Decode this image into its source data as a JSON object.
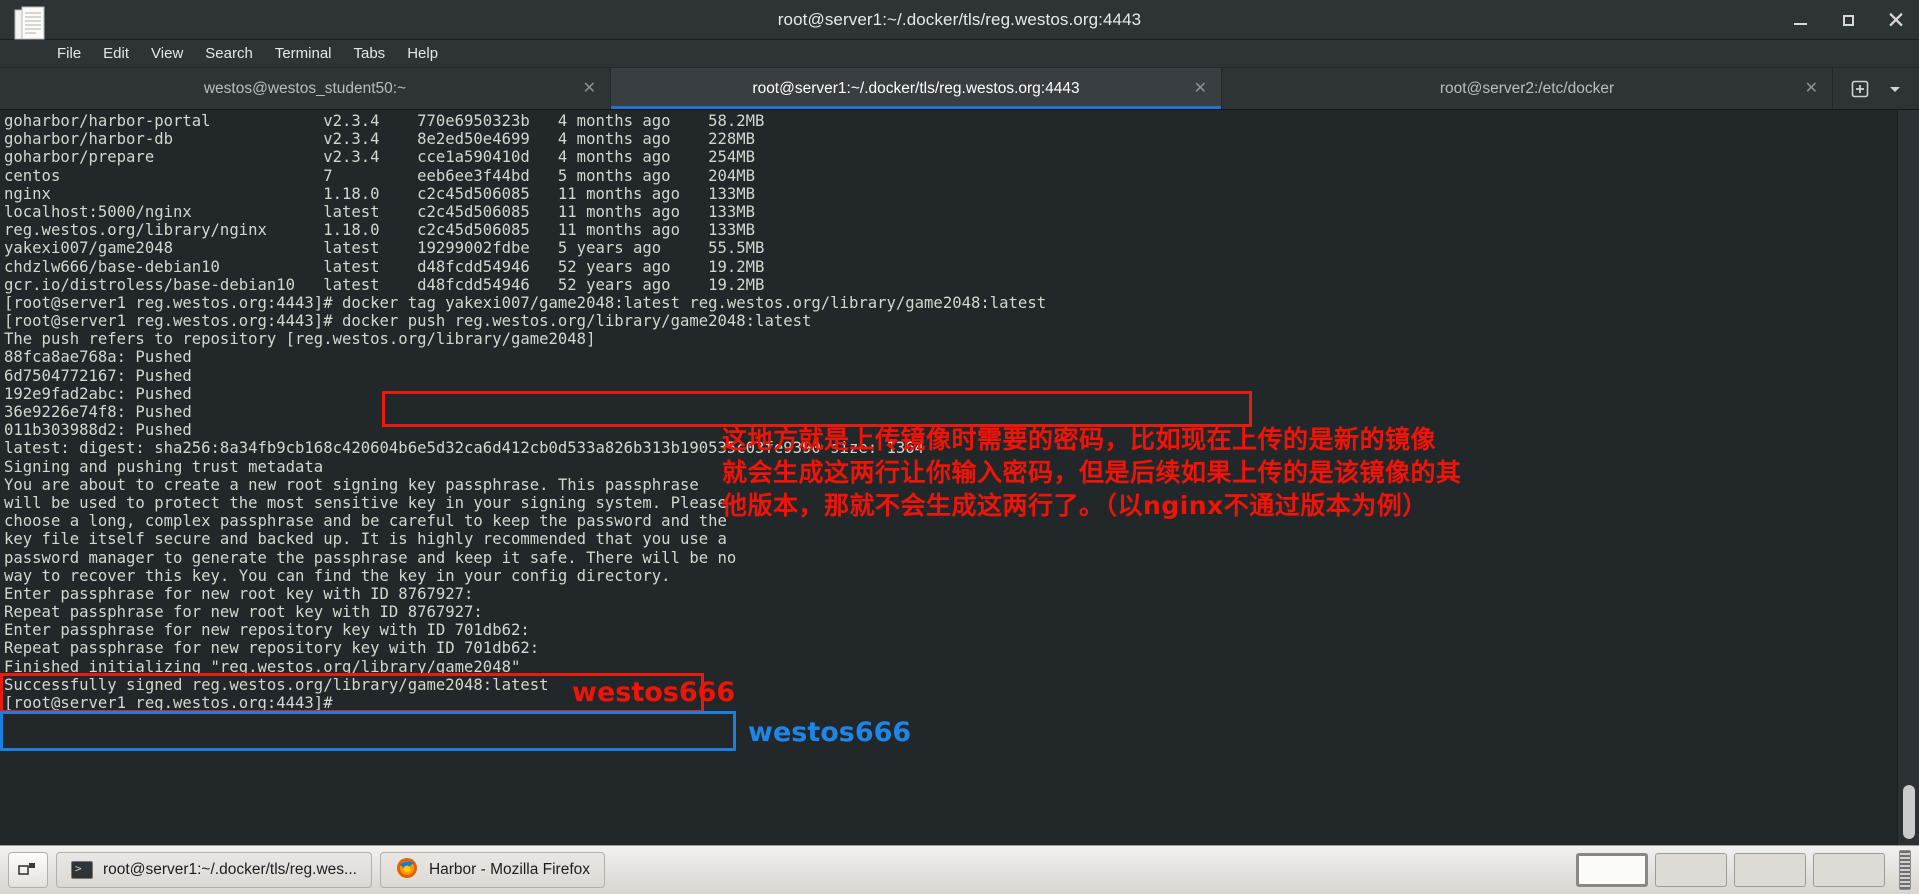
{
  "window": {
    "title": "root@server1:~/.docker/tls/reg.westos.org:4443",
    "minimize_label": "–",
    "maximize_label": "□",
    "close_label": "✕",
    "app_icon": "document-icon"
  },
  "menubar": {
    "items": [
      {
        "label": "File"
      },
      {
        "label": "Edit"
      },
      {
        "label": "View"
      },
      {
        "label": "Search"
      },
      {
        "label": "Terminal"
      },
      {
        "label": "Tabs"
      },
      {
        "label": "Help"
      }
    ]
  },
  "tabs": {
    "items": [
      {
        "label": "westos@westos_student50:~",
        "active": false,
        "close": "✕"
      },
      {
        "label": "root@server1:~/.docker/tls/reg.westos.org:4443",
        "active": true,
        "close": "✕"
      },
      {
        "label": "root@server2:/etc/docker",
        "active": false,
        "close": "✕"
      }
    ],
    "new_tab_icon": "new-tab-icon",
    "menu_icon": "chevron-down-icon"
  },
  "terminal": {
    "lines": [
      "goharbor/harbor-portal            v2.3.4    770e6950323b   4 months ago    58.2MB",
      "goharbor/harbor-db                v2.3.4    8e2ed50e4699   4 months ago    228MB",
      "goharbor/prepare                  v2.3.4    cce1a590410d   4 months ago    254MB",
      "centos                            7         eeb6ee3f44bd   5 months ago    204MB",
      "nginx                             1.18.0    c2c45d506085   11 months ago   133MB",
      "localhost:5000/nginx              latest    c2c45d506085   11 months ago   133MB",
      "reg.westos.org/library/nginx      1.18.0    c2c45d506085   11 months ago   133MB",
      "yakexi007/game2048                latest    19299002fdbe   5 years ago     55.5MB",
      "chdzlw666/base-debian10           latest    d48fcdd54946   52 years ago    19.2MB",
      "gcr.io/distroless/base-debian10   latest    d48fcdd54946   52 years ago    19.2MB",
      "[root@server1 reg.westos.org:4443]# docker tag yakexi007/game2048:latest reg.westos.org/library/game2048:latest",
      "[root@server1 reg.westos.org:4443]# docker push reg.westos.org/library/game2048:latest",
      "The push refers to repository [reg.westos.org/library/game2048]",
      "88fca8ae768a: Pushed",
      "6d7504772167: Pushed",
      "192e9fad2abc: Pushed",
      "36e9226e74f8: Pushed",
      "011b303988d2: Pushed",
      "latest: digest: sha256:8a34fb9cb168c420604b6e5d32ca6d412cb0d533a826b313b190535c03fe9390 size: 1364",
      "Signing and pushing trust metadata",
      "You are about to create a new root signing key passphrase. This passphrase",
      "will be used to protect the most sensitive key in your signing system. Please",
      "choose a long, complex passphrase and be careful to keep the password and the",
      "key file itself secure and backed up. It is highly recommended that you use a",
      "password manager to generate the passphrase and keep it safe. There will be no",
      "way to recover this key. You can find the key in your config directory.",
      "Enter passphrase for new root key with ID 8767927:",
      "Repeat passphrase for new root key with ID 8767927:",
      "Enter passphrase for new repository key with ID 701db62:",
      "Repeat passphrase for new repository key with ID 701db62:",
      "Finished initializing \"reg.westos.org/library/game2048\"",
      "Successfully signed reg.westos.org/library/game2048:latest",
      "[root@server1 reg.westos.org:4443]#"
    ]
  },
  "annotations": {
    "cjk_note": "这地方就是上传镜像时需要的密码，比如现在上传的是新的镜像 就会生成这两行让你输入密码，但是后续如果上传的是该镜像的其他版本，那就不会生成这两行了。（以nginx不通过版本为例）",
    "root_key_password": "westos666",
    "repo_key_password": "westos666",
    "colors": {
      "red": "#f01408",
      "blue": "#1f86e8"
    }
  },
  "taskbar": {
    "show_desktop_icon": "show-desktop-icon",
    "windows": [
      {
        "icon": "terminal-icon",
        "label": "root@server1:~/.docker/tls/reg.wes..."
      },
      {
        "icon": "firefox-icon",
        "label": "Harbor - Mozilla Firefox"
      }
    ],
    "workspaces": [
      {
        "active": true
      },
      {
        "active": false
      },
      {
        "active": false
      },
      {
        "active": false
      }
    ]
  }
}
